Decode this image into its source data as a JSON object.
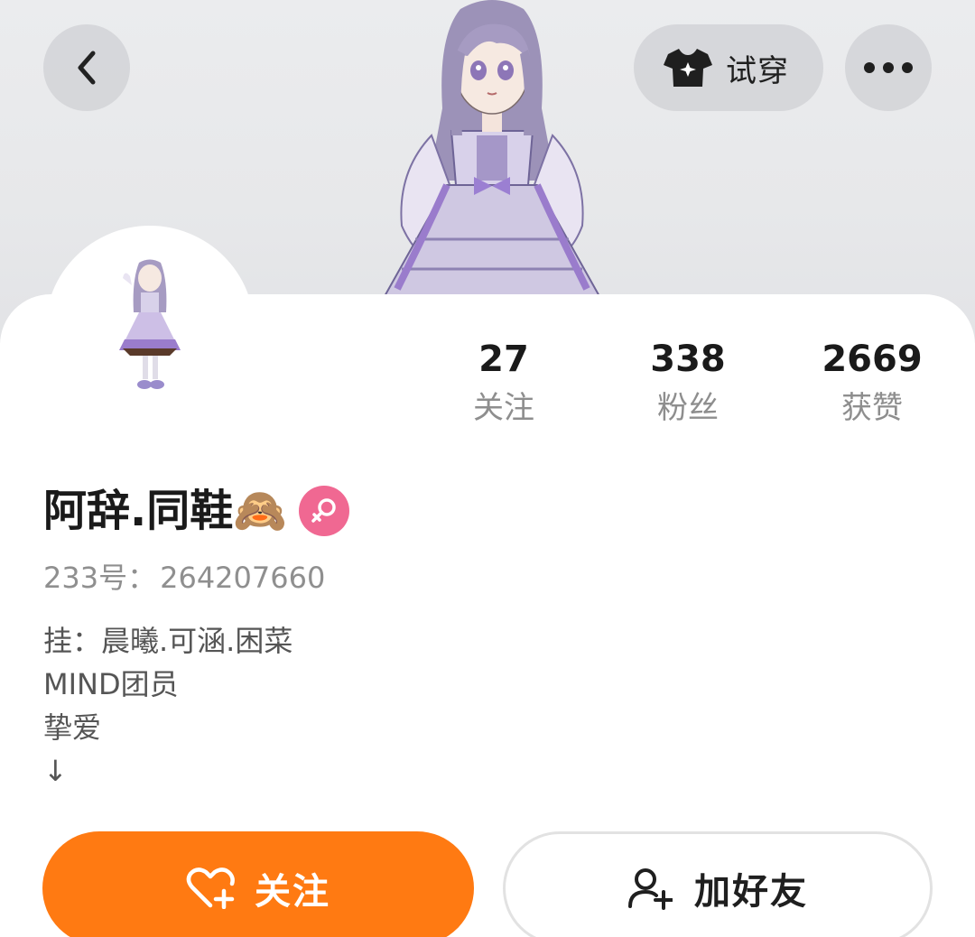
{
  "header": {
    "back_icon": "chevron-left-icon",
    "tryon_icon": "tshirt-sparkle-icon",
    "tryon_label": "试穿",
    "more_icon": "more-dots-icon"
  },
  "profile": {
    "nickname": "阿辞.同鞋🙈",
    "gender_icon": "female-icon",
    "gender_color": "#f06892",
    "uid_label": "233号：",
    "uid": "264207660"
  },
  "stats": [
    {
      "value": "27",
      "label": "关注"
    },
    {
      "value": "338",
      "label": "粉丝"
    },
    {
      "value": "2669",
      "label": "获赞"
    }
  ],
  "bio": [
    "挂：晨曦.可涵.困菜",
    "MIND团员",
    "挚爱",
    "↓"
  ],
  "actions": {
    "follow_label": "关注",
    "follow_color": "#ff7a12",
    "add_friend_label": "加好友"
  }
}
